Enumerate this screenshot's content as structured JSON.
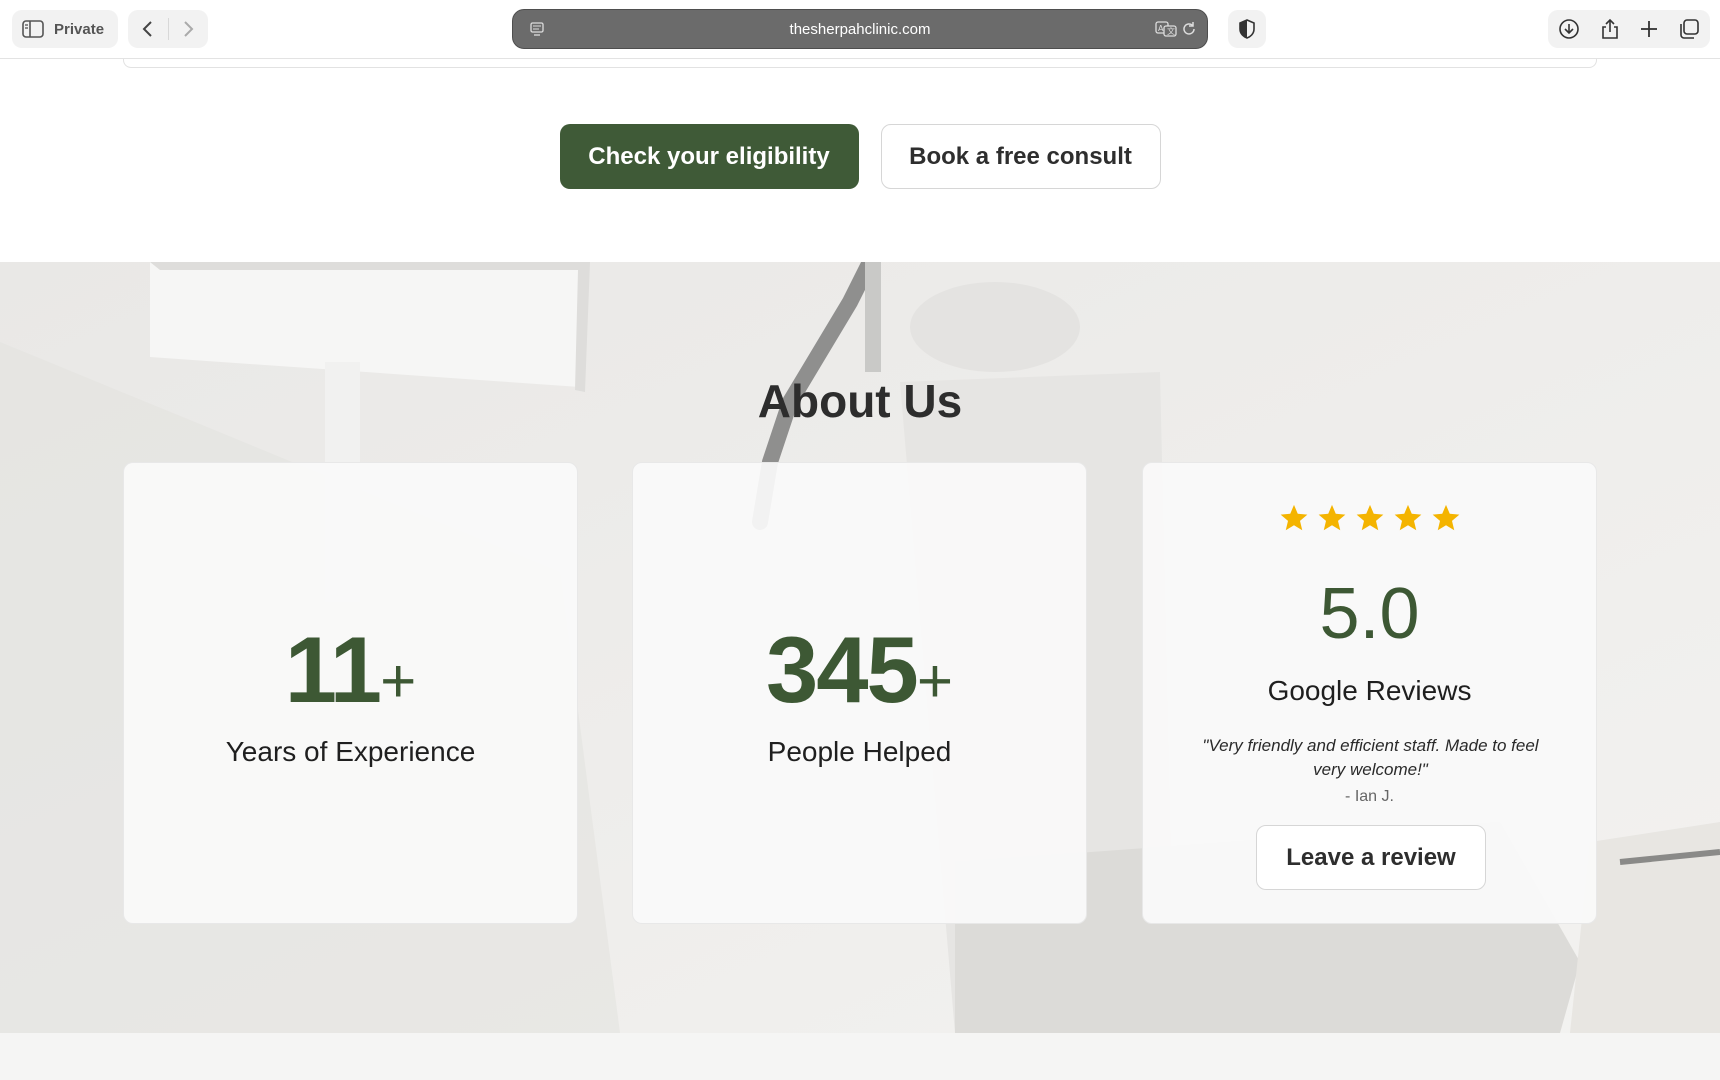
{
  "browser": {
    "private_label": "Private",
    "url": "thesherpahclinic.com"
  },
  "cta": {
    "primary_label": "Check your eligibility",
    "secondary_label": "Book a free consult"
  },
  "about": {
    "title": "About Us",
    "stats": [
      {
        "number": "11",
        "suffix": "+",
        "label": "Years of Experience"
      },
      {
        "number": "345",
        "suffix": "+",
        "label": "People Helped"
      }
    ],
    "reviews": {
      "stars": 5,
      "rating": "5.0",
      "label": "Google Reviews",
      "quote": "\"Very friendly and efficient staff. Made to feel very welcome!\"",
      "author": "- Ian J.",
      "button_label": "Leave a review"
    }
  },
  "colors": {
    "accent": "#3f5a37",
    "star": "#f4b400"
  }
}
